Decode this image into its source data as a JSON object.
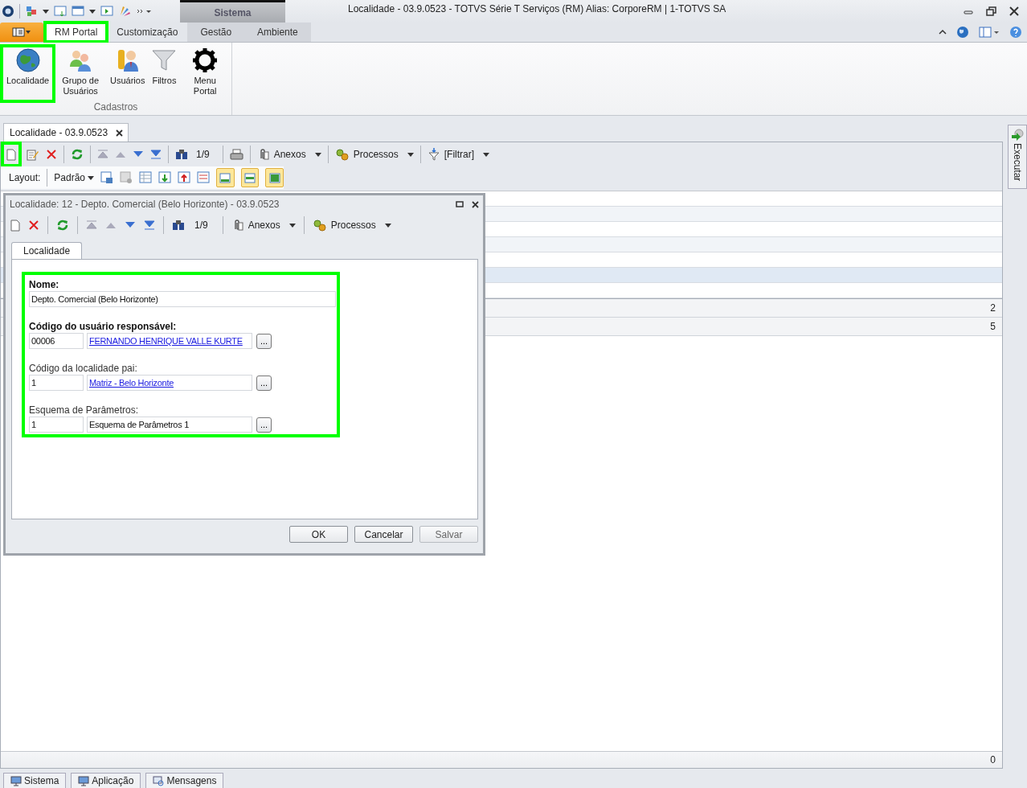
{
  "window": {
    "title": "Localidade - 03.9.0523 - TOTVS Série T Serviços (RM) Alias: CorporeRM | 1-TOTVS SA"
  },
  "context_tab_group": {
    "label": "Sistema"
  },
  "ribbon_tabs": [
    {
      "label": "RM Portal",
      "selected": true,
      "highlighted": true,
      "context": false
    },
    {
      "label": "Customização",
      "selected": false,
      "highlighted": false,
      "context": false
    },
    {
      "label": "Gestão",
      "selected": false,
      "highlighted": false,
      "context": true
    },
    {
      "label": "Ambiente",
      "selected": false,
      "highlighted": false,
      "context": true
    }
  ],
  "ribbon_group": {
    "label": "Cadastros",
    "buttons": [
      {
        "label": "Localidade",
        "kind": "globe",
        "highlighted": true
      },
      {
        "label": "Grupo de Usuários",
        "kind": "users",
        "highlighted": false
      },
      {
        "label": "Usuários",
        "kind": "user-key",
        "highlighted": false
      },
      {
        "label": "Filtros",
        "kind": "funnel",
        "highlighted": false
      },
      {
        "label": "Menu Portal",
        "kind": "gear",
        "highlighted": false
      }
    ]
  },
  "document_tab": {
    "label": "Localidade - 03.9.0523"
  },
  "toolbar": {
    "new_highlighted": true,
    "counter": "1/9",
    "menus": [
      {
        "label": "Anexos",
        "kind": "attach"
      },
      {
        "label": "Processos",
        "kind": "process"
      },
      {
        "label": "[Filtrar]",
        "kind": "filter"
      }
    ]
  },
  "layout_bar": {
    "label": "Layout:",
    "preset": "Padrão",
    "view_toggles": [
      {
        "selected": true
      },
      {
        "selected": true
      },
      {
        "selected": true
      }
    ]
  },
  "grid": {
    "rows": [
      {
        "selected": false
      },
      {
        "selected": false
      },
      {
        "selected": false
      },
      {
        "selected": false
      },
      {
        "selected": false
      },
      {
        "selected": true
      },
      {
        "selected": false
      }
    ],
    "group_rows": [
      {
        "count": "2"
      },
      {
        "count": "5"
      }
    ],
    "footer_count": "0"
  },
  "side_panel": {
    "label": "Executar"
  },
  "dialog": {
    "title": "Localidade: 12 - Depto. Comercial (Belo Horizonte) - 03.9.0523",
    "counter": "1/9",
    "menus": [
      {
        "label": "Anexos",
        "kind": "attach"
      },
      {
        "label": "Processos",
        "kind": "process"
      }
    ],
    "tabs": [
      {
        "label": "Localidade",
        "selected": true
      }
    ],
    "fields_highlighted": true,
    "fields": [
      {
        "kind": "text",
        "label": "Nome:",
        "required": true,
        "value": "Depto. Comercial (Belo Horizonte)"
      },
      {
        "kind": "lookup",
        "label": "Código do usuário responsável:",
        "required": true,
        "code": "00006",
        "description": "FERNANDO HENRIQUE VALLE KURTE",
        "link": true,
        "button": "..."
      },
      {
        "kind": "lookup",
        "label": "Código da localidade pai:",
        "required": false,
        "code": "1",
        "description": "Matriz - Belo Horizonte",
        "link": true,
        "button": "..."
      },
      {
        "kind": "lookup",
        "label": "Esquema de Parâmetros:",
        "required": false,
        "code": "1",
        "description": "Esquema de Parâmetros 1",
        "link": false,
        "button": "..."
      }
    ],
    "buttons": [
      {
        "label": "OK",
        "disabled": false
      },
      {
        "label": "Cancelar",
        "disabled": false
      },
      {
        "label": "Salvar",
        "disabled": true
      }
    ]
  },
  "bottom_tabs": [
    {
      "label": "Sistema",
      "kind": "monitor"
    },
    {
      "label": "Aplicação",
      "kind": "monitor"
    },
    {
      "label": "Mensagens",
      "kind": "messages"
    }
  ]
}
